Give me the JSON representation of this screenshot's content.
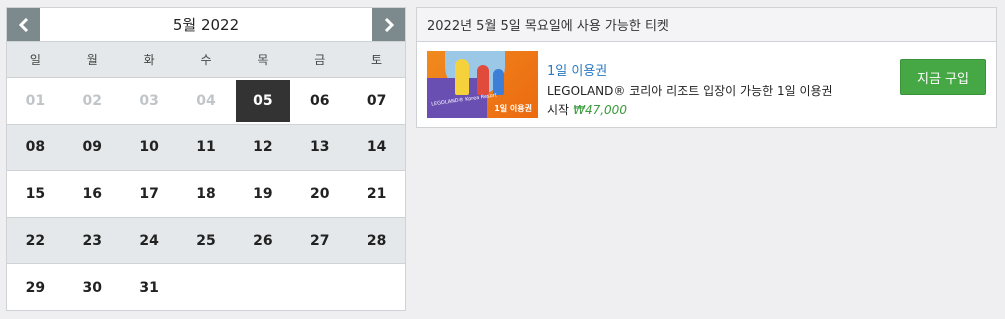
{
  "calendar": {
    "title": "5월 2022",
    "prev_icon": "chevron-left-icon",
    "next_icon": "chevron-right-icon",
    "weekdays": [
      "일",
      "월",
      "화",
      "수",
      "목",
      "금",
      "토"
    ],
    "weeks": [
      [
        {
          "d": "01",
          "s": "muted"
        },
        {
          "d": "02",
          "s": "muted"
        },
        {
          "d": "03",
          "s": "muted"
        },
        {
          "d": "04",
          "s": "muted"
        },
        {
          "d": "05",
          "s": "selected"
        },
        {
          "d": "06",
          "s": "normal"
        },
        {
          "d": "07",
          "s": "normal"
        }
      ],
      [
        {
          "d": "08",
          "s": "normal"
        },
        {
          "d": "09",
          "s": "normal"
        },
        {
          "d": "10",
          "s": "normal"
        },
        {
          "d": "11",
          "s": "normal"
        },
        {
          "d": "12",
          "s": "normal"
        },
        {
          "d": "13",
          "s": "normal"
        },
        {
          "d": "14",
          "s": "normal"
        }
      ],
      [
        {
          "d": "15",
          "s": "normal"
        },
        {
          "d": "16",
          "s": "normal"
        },
        {
          "d": "17",
          "s": "normal"
        },
        {
          "d": "18",
          "s": "normal"
        },
        {
          "d": "19",
          "s": "normal"
        },
        {
          "d": "20",
          "s": "normal"
        },
        {
          "d": "21",
          "s": "normal"
        }
      ],
      [
        {
          "d": "22",
          "s": "normal"
        },
        {
          "d": "23",
          "s": "normal"
        },
        {
          "d": "24",
          "s": "normal"
        },
        {
          "d": "25",
          "s": "normal"
        },
        {
          "d": "26",
          "s": "normal"
        },
        {
          "d": "27",
          "s": "normal"
        },
        {
          "d": "28",
          "s": "normal"
        }
      ],
      [
        {
          "d": "29",
          "s": "normal"
        },
        {
          "d": "30",
          "s": "normal"
        },
        {
          "d": "31",
          "s": "normal"
        },
        {
          "d": "",
          "s": "empty"
        },
        {
          "d": "",
          "s": "empty"
        },
        {
          "d": "",
          "s": "empty"
        },
        {
          "d": "",
          "s": "empty"
        }
      ]
    ]
  },
  "panel": {
    "header": "2022년 5월 5일 목요일에 사용 가능한 티켓",
    "ticket": {
      "name": "1일 이용권",
      "description": "LEGOLAND® 코리아 리조트 입장이 가능한 1일 이용권",
      "price_prefix": "시작",
      "price": "₩47,000",
      "image_brand": "LEGOLAND® Korea Resort",
      "image_tag": "1일 이용권",
      "buy_label": "지금 구입"
    }
  },
  "colors": {
    "nav_button": "#7c8a8e",
    "selected_day": "#333333",
    "alt_row": "#e5e8ea",
    "link_blue": "#2a7ac0",
    "price_green": "#3a9a3a",
    "buy_button": "#45a845"
  }
}
